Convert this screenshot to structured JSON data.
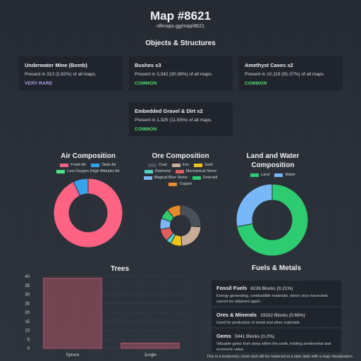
{
  "header": {
    "title": "Map #8621",
    "url": "nftmaps.gg/map/8621"
  },
  "objects": {
    "title": "Objects & Structures",
    "cards": [
      {
        "name": "Underwater Mine (Bomb)",
        "presence": "Present in 313 (2.82%) of all maps.",
        "rarity": "VERY RARE",
        "rarity_color": "#b9a6f0"
      },
      {
        "name": "Bushes x3",
        "presence": "Present in 3,342 (30.08%) of all maps.",
        "rarity": "COMMON",
        "rarity_color": "#4ee46a"
      },
      {
        "name": "Amethyst Caves x2",
        "presence": "Present in 10,119 (91.07%) of all maps.",
        "rarity": "COMMON",
        "rarity_color": "#4ee46a"
      },
      {
        "name": "Embedded Gravel & Dirt x2",
        "presence": "Present in 1,325 (11.93%) of all maps.",
        "rarity": "COMMON",
        "rarity_color": "#4ee46a"
      }
    ]
  },
  "chart_data": [
    {
      "type": "pie",
      "title": "Air Composition",
      "labels": [
        "Fresh Air",
        "Stale Air",
        "Low-Oxygen (High Altitude) Air"
      ],
      "colors": [
        "#ff6384",
        "#36a2eb",
        "#4be383"
      ],
      "values": [
        93,
        7,
        0
      ]
    },
    {
      "type": "pie",
      "title": "Ore Composition",
      "labels": [
        "Coal",
        "Iron",
        "Gold",
        "Diamond",
        "Mechanical Stone",
        "Magical Blue Stone",
        "Emerald",
        "Copper"
      ],
      "colors": [
        "#4b4f57",
        "#c9ad96",
        "#f0c419",
        "#4fd1c5",
        "#e05d5d",
        "#7ab8f5",
        "#2ecc71",
        "#e8892b"
      ],
      "values": [
        26,
        23,
        9,
        4,
        10,
        9,
        8,
        11
      ]
    },
    {
      "type": "pie",
      "title": "Land and Water Composition",
      "labels": [
        "Land",
        "Water"
      ],
      "colors": [
        "#2ecc71",
        "#79b8f8"
      ],
      "values": [
        72,
        28
      ]
    },
    {
      "type": "bar",
      "title": "Trees",
      "categories": [
        "Spruce",
        "Jungle"
      ],
      "values": [
        39,
        3
      ],
      "ylim": [
        0,
        40
      ],
      "yticks": [
        0,
        5,
        10,
        15,
        20,
        25,
        30,
        35,
        40
      ],
      "bar_color": "#c85a6e"
    }
  ],
  "fuels": {
    "title": "Fuels & Metals",
    "items": [
      {
        "name": "Fossil Fuels",
        "blocks": "6226 Blocks (0.21%)",
        "desc": "Energy generating, combustible materials, which once harvested cannot be obtained again."
      },
      {
        "name": "Ores & Minerals",
        "blocks": "19332 Blocks (0.66%)",
        "desc": "Used for production of metal and other materials."
      },
      {
        "name": "Gems",
        "blocks": "5941 Blocks (0.2%)",
        "desc": "Valuable gems from deep within the earth, holding sentimental and economic value."
      }
    ]
  },
  "footer": "This is a temporary cover and will be replaced at a later date with a map visualisation."
}
